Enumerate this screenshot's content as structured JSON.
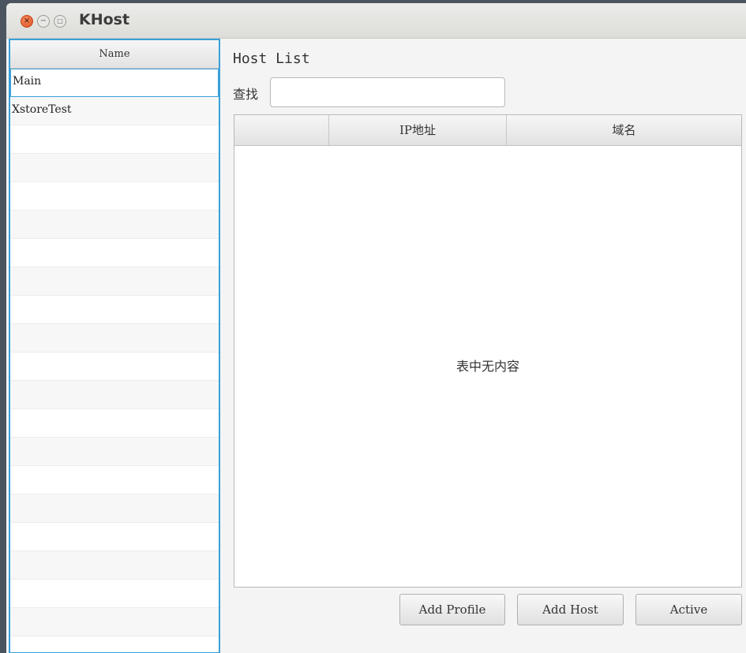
{
  "window": {
    "title": "KHost",
    "close_glyph": "×",
    "minimize_glyph": "−",
    "maximize_glyph": "□"
  },
  "profiles": {
    "header": "Name",
    "items": [
      {
        "label": "Main",
        "selected": true
      },
      {
        "label": "XstoreTest",
        "selected": false
      },
      {
        "label": "",
        "selected": false
      },
      {
        "label": "",
        "selected": false
      },
      {
        "label": "",
        "selected": false
      },
      {
        "label": "",
        "selected": false
      },
      {
        "label": "",
        "selected": false
      },
      {
        "label": "",
        "selected": false
      },
      {
        "label": "",
        "selected": false
      },
      {
        "label": "",
        "selected": false
      },
      {
        "label": "",
        "selected": false
      },
      {
        "label": "",
        "selected": false
      },
      {
        "label": "",
        "selected": false
      },
      {
        "label": "",
        "selected": false
      },
      {
        "label": "",
        "selected": false
      },
      {
        "label": "",
        "selected": false
      },
      {
        "label": "",
        "selected": false
      },
      {
        "label": "",
        "selected": false
      },
      {
        "label": "",
        "selected": false
      },
      {
        "label": "",
        "selected": false
      },
      {
        "label": "",
        "selected": false
      }
    ]
  },
  "main": {
    "title": "Host List",
    "search_label": "查找",
    "search_value": "",
    "search_placeholder": "",
    "table": {
      "columns": [
        "",
        "IP地址",
        "域名"
      ],
      "rows": [],
      "empty_message": "表中无内容"
    },
    "buttons": {
      "add_profile": "Add Profile",
      "add_host": "Add Host",
      "active": "Active"
    }
  },
  "colors": {
    "accent": "#3aa0d8",
    "close_button": "#e0531f"
  }
}
